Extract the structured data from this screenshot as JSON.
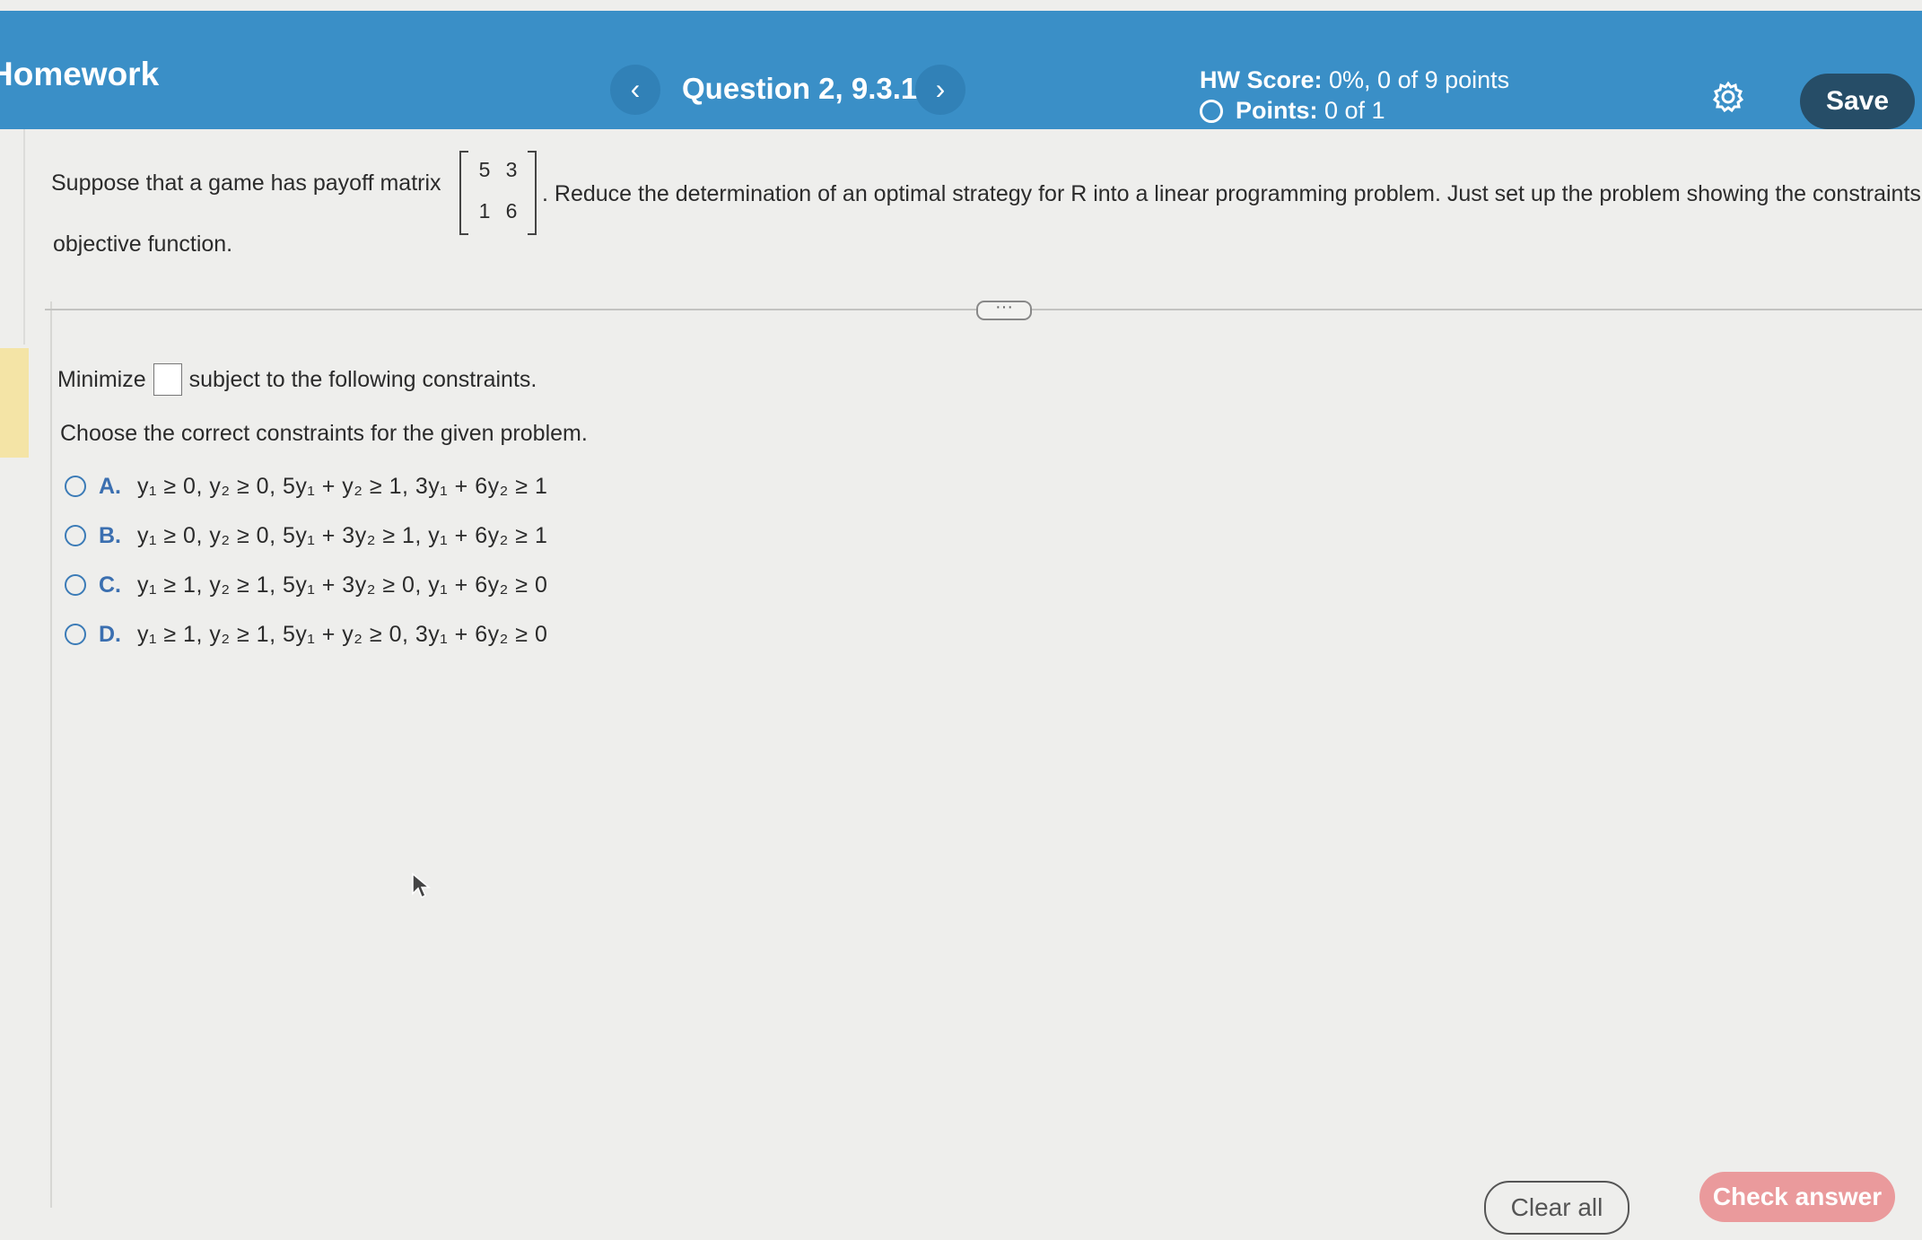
{
  "header": {
    "title": "Homework",
    "question_title": "Question 2, 9.3.1",
    "prev_icon": "‹",
    "next_icon": "›",
    "hw_score_label": "HW Score:",
    "hw_score_value": " 0%, 0 of 9 points",
    "points_label": "Points:",
    "points_value": " 0 of 1",
    "save_label": "Save"
  },
  "problem": {
    "prompt_before": "Suppose that a game has payoff matrix",
    "matrix": [
      [
        "5",
        "3"
      ],
      [
        "1",
        "6"
      ]
    ],
    "prompt_after": ". Reduce the determination of an optimal strategy for R into a linear programming problem.  Just set up the problem showing the constraints and the",
    "prompt_end": "objective function."
  },
  "answer": {
    "minimize_label": "Minimize",
    "minimize_suffix": "subject to the following constraints.",
    "choose_label": "Choose the correct constraints for the given problem.",
    "options": [
      {
        "letter": "A.",
        "text": "y₁ ≥ 0,  y₂ ≥ 0,  5y₁ + y₂ ≥ 1,  3y₁ + 6y₂ ≥ 1"
      },
      {
        "letter": "B.",
        "text": "y₁ ≥ 0,  y₂ ≥ 0,  5y₁ + 3y₂ ≥ 1,  y₁ + 6y₂ ≥ 1"
      },
      {
        "letter": "C.",
        "text": "y₁ ≥ 1,  y₂ ≥ 1,  5y₁ + 3y₂ ≥ 0,  y₁ + 6y₂ ≥ 0"
      },
      {
        "letter": "D.",
        "text": "y₁ ≥ 1,  y₂ ≥ 1,  5y₁ + y₂ ≥ 0,  3y₁ + 6y₂ ≥ 0"
      }
    ]
  },
  "footer": {
    "clear_label": "Clear all",
    "check_label": "Check answer"
  },
  "colors": {
    "header_bg": "#3a8fc7",
    "save_bg": "#264d67",
    "check_bg": "#ea9a9c",
    "radio": "#3b7bb7"
  }
}
